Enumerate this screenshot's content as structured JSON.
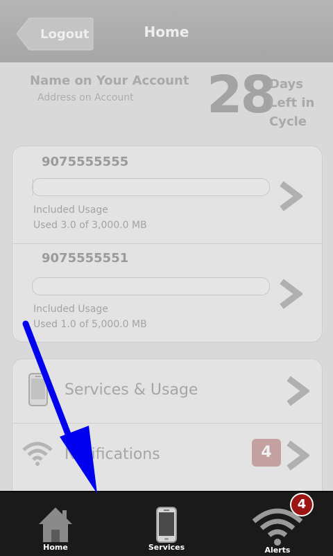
{
  "header": {
    "back_label": "Logout",
    "title": "Home"
  },
  "account": {
    "name": "Name on Your Account",
    "address": "Address on Account",
    "days_left": "28",
    "days_label_1": "Days",
    "days_label_2": "Left in",
    "days_label_3": "Cycle"
  },
  "lines": [
    {
      "number": "9075555555",
      "usage_title": "Included Usage",
      "usage_text": "Used 3.0 of 3,000.0 MB",
      "used_fraction": 0.001
    },
    {
      "number": "9075555551",
      "usage_title": "Included Usage",
      "usage_text": "Used 1.0 of 5,000.0 MB",
      "used_fraction": 0.0002
    }
  ],
  "menu": {
    "services_label": "Services & Usage",
    "notifications_label": "Notifications",
    "notifications_count": "4"
  },
  "tabbar": {
    "home_label": "Home",
    "services_label": "Services",
    "alerts_label": "Alerts",
    "alerts_badge": "4"
  },
  "colors": {
    "arrow": "#0000ee",
    "badge": "#9d1414"
  }
}
